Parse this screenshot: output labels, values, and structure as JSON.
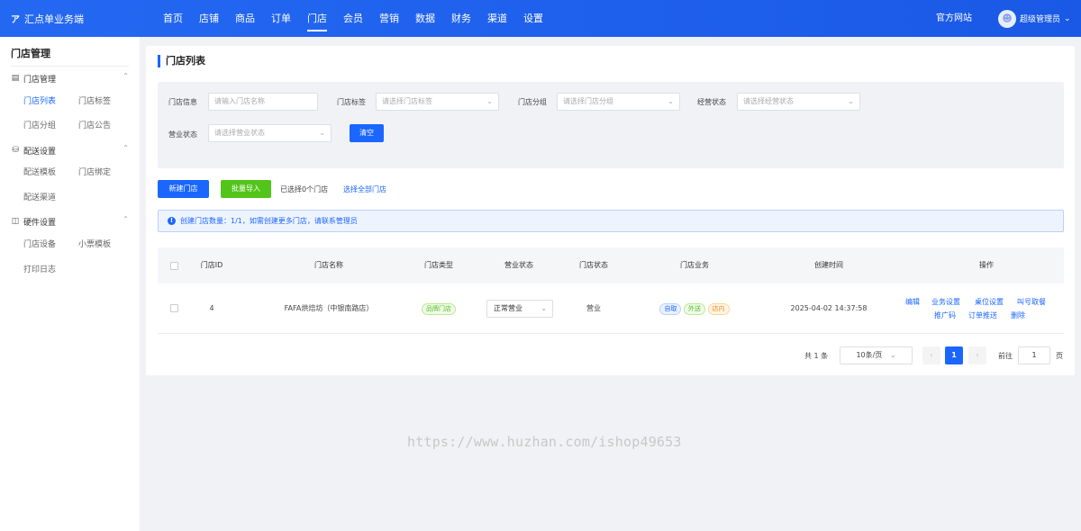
{
  "brand": {
    "logo": "ア",
    "name": "汇点单业务端"
  },
  "topnav": [
    "首页",
    "店铺",
    "商品",
    "订单",
    "门店",
    "会员",
    "营销",
    "数据",
    "财务",
    "渠道",
    "设置"
  ],
  "header": {
    "official_site": "官方网站",
    "user_name": "超级管理员"
  },
  "sidebar": {
    "title": "门店管理",
    "groups": [
      {
        "label": "门店管理",
        "items": [
          "门店列表",
          "门店标签",
          "门店分组",
          "门店公告"
        ]
      },
      {
        "label": "配送设置",
        "items": [
          "配送模板",
          "门店绑定",
          "配送渠道"
        ]
      },
      {
        "label": "硬件设置",
        "items": [
          "门店设备",
          "小票模板",
          "打印日志"
        ]
      }
    ]
  },
  "page": {
    "title": "门店列表"
  },
  "filters": {
    "store_info": {
      "label": "门店信息",
      "placeholder": "请输入门店名称"
    },
    "store_tag": {
      "label": "门店标签",
      "placeholder": "请选择门店标签"
    },
    "store_group": {
      "label": "门店分组",
      "placeholder": "请选择门店分组"
    },
    "operate_status": {
      "label": "经营状态",
      "placeholder": "请选择经营状态"
    },
    "business_status": {
      "label": "营业状态",
      "placeholder": "请选择营业状态"
    },
    "clear": "清空"
  },
  "actions": {
    "new_store": "新建门店",
    "batch_import": "批量导入",
    "selected": "已选择0个门店",
    "select_all": "选择全部门店"
  },
  "notice": "创建门店数量：1/1，如需创建更多门店，请联系管理员",
  "table": {
    "headers": [
      "门店ID",
      "门店名称",
      "门店类型",
      "营业状态",
      "门店状态",
      "门店业务",
      "创建时间",
      "操作"
    ],
    "rows": [
      {
        "id": "4",
        "name": "FAFA烘焙坊（中银南路店）",
        "type": "品牌门店",
        "business_status": "正常营业",
        "store_status": "营业",
        "services": [
          "自取",
          "外送",
          "店内"
        ],
        "created": "2025-04-02 14:37:58",
        "ops": [
          "编辑",
          "业务设置",
          "桌位设置",
          "叫号取餐",
          "推广码",
          "订单推送",
          "删除"
        ]
      }
    ]
  },
  "pagination": {
    "total": "共 1 条",
    "page_size": "10条/页",
    "current": "1",
    "goto_label": "前往",
    "goto_value": "1",
    "page_suffix": "页"
  },
  "watermark": "https://www.huzhan.com/ishop49653"
}
